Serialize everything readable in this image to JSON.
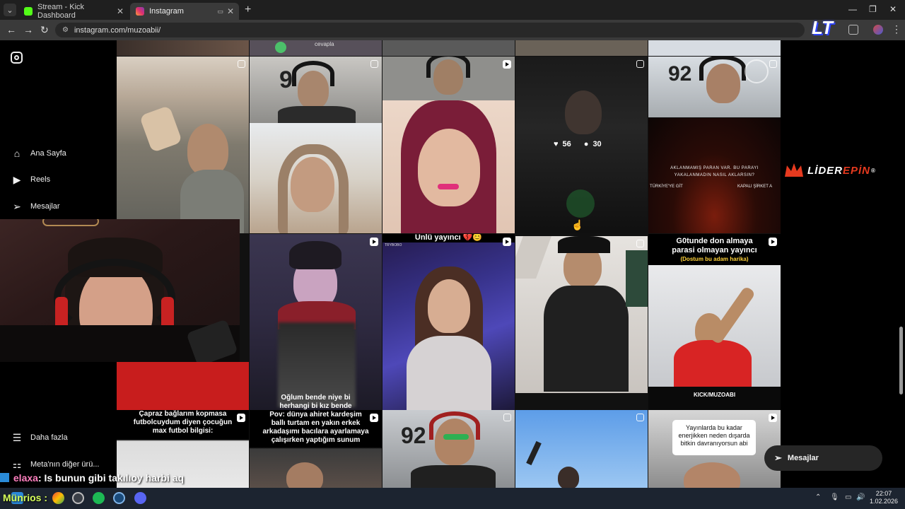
{
  "browser": {
    "tabs": [
      {
        "title": "Stream - Kick Dashboard",
        "favicon_color": "#53fc18"
      },
      {
        "title": "Instagram",
        "favicon_color": "#e1306c"
      }
    ],
    "url": "instagram.com/muzoabii/"
  },
  "sidebar": {
    "items": [
      {
        "label": "Ana Sayfa",
        "icon": "home-icon"
      },
      {
        "label": "Reels",
        "icon": "reels-icon"
      },
      {
        "label": "Mesajlar",
        "icon": "send-icon"
      },
      {
        "label": "Daha fazla",
        "icon": "menu-icon"
      },
      {
        "label": "Meta'nın diğer ürü...",
        "icon": "meta-icon"
      }
    ]
  },
  "grid": {
    "captions": {
      "top_partial": "cevapla",
      "unlu": "Ünlü yayıncı 💔😊",
      "gotunde_line1": "G0tunde don almaya",
      "gotunde_line2": "parasi olmayan yayıncı",
      "gotunde_sub": "(Dostum bu adam harika)",
      "aklanmamis_1": "AKLANMAMIŞ PARAN VAR. BU PARAYI",
      "aklanmamis_2": "YAKALANMADIN NASIL AKLARSIN?",
      "aklanmamis_3": "TÜRKİYE'YE GİT",
      "aklanmamis_4": "KAPALI ŞİRKET A",
      "oglum_1": "Oğlum bende niye bi",
      "oglum_2": "herhangi bi kız bende",
      "kick": "KICK/MUZOABI",
      "capraz_1": "Çapraz bağlarım kopmasa",
      "capraz_2": "futbolcuydum diyen çocuğun",
      "capraz_3": "max futbol bilgisi:",
      "pov_1": "Pov: dünya ahiret kardeşim",
      "pov_2": "ballı turtam en yakın erkek",
      "pov_3": "arkadaşımı bacılara ayarlamaya",
      "pov_4": "çalışırken yaptığım sunum",
      "yayin_1": "Yayınlarda bu kadar",
      "yayin_2": "enerjikken neden dışarda",
      "yayin_3": "bitkin davranıyorsun abi",
      "trybobo": "TRYBOBO"
    },
    "hover_stats": {
      "likes": "56",
      "comments": "30"
    }
  },
  "sponsor": {
    "part1": "LİDER",
    "part2": "EPİN",
    "mark": "®"
  },
  "channel_logo": "LT",
  "messages_pill": {
    "label": "Mesajlar"
  },
  "chat": {
    "line1_user": "elaxa",
    "line1_text": ": Is bunun gibi takılıoy harbi aq",
    "line2": "Münrios :"
  },
  "taskbar": {
    "time": "22:07",
    "date": "1.02.2026"
  },
  "colors": {
    "accent": "#e63a1f",
    "kick_green": "#53fc18",
    "instagram": "#e1306c"
  }
}
